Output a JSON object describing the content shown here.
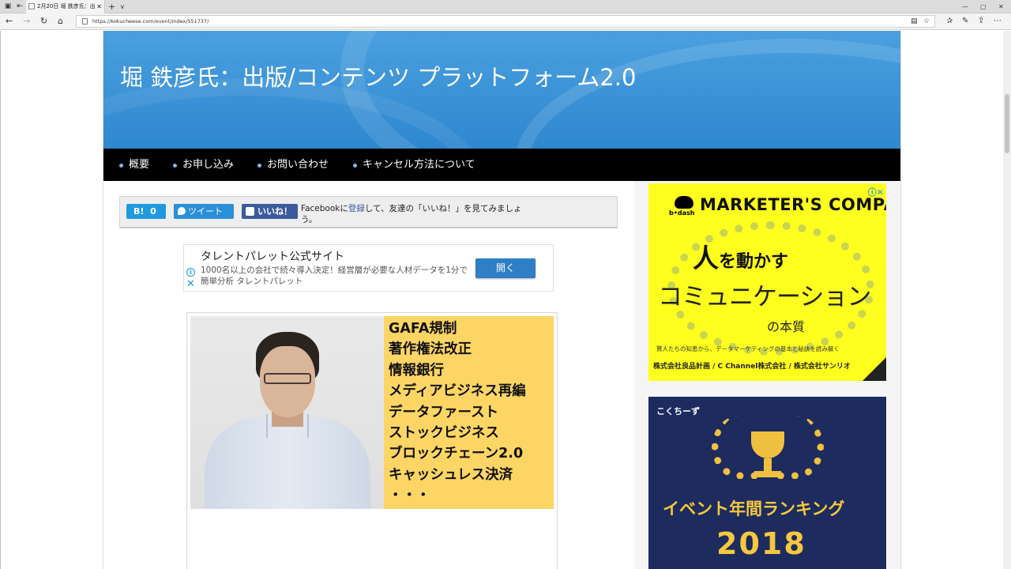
{
  "browser": {
    "tab_title": "2月20日 堀 鉄彦氏：出",
    "tab_close": "✕",
    "new_tab": "+",
    "tab_menu": "∨",
    "url": "https://kokucheese.com/event/index/551737/",
    "window_buttons": [
      "—",
      "▢",
      "✕"
    ]
  },
  "site": {
    "title": "堀 鉄彦氏：出版/コンテンツ プラットフォーム2.0"
  },
  "nav": {
    "items": [
      "概要",
      "お申し込み",
      "お問い合わせ",
      "キャンセル方法について"
    ]
  },
  "share": {
    "hatena_label": "B!",
    "hatena_count": "0",
    "tweet_label": "ツイート",
    "like_label": "いいね！",
    "fb_prefix": "Facebookに",
    "fb_link": "登録",
    "fb_suffix": "して、友達の「いいね！」を見てみましょう。"
  },
  "text_ad": {
    "title": "タレントパレット公式サイト",
    "description": "1000名以上の会社で続々導入決定！経営層が必要な人材データを1分で簡単分析 タレントパレット",
    "button": "開く"
  },
  "article_image": {
    "keywords": [
      "GAFA規制",
      "著作権法改正",
      "情報銀行",
      "メディアビジネス再編",
      "データファースト",
      "ストックビジネス",
      "ブロックチェーン2.0",
      "キャッシュレス決済",
      "・・・"
    ]
  },
  "side_ad1": {
    "logo": "b•dash",
    "brand": "MARKETER'S COMPASS",
    "headline_big": "人",
    "headline_rest": "を動かす",
    "line2": "コミュニケーション",
    "line3": "の本質",
    "foot1": "賢人たちの知恵から、データマーケティングの基本と秘訣を読み解く",
    "foot2": "株式会社良品計画 / C Channel株式会社 / 株式会社サンリオ",
    "corner": "check"
  },
  "side_ad2": {
    "logo": "こくちーず",
    "rank_text": "イベント年間ランキング",
    "year": "2018"
  }
}
